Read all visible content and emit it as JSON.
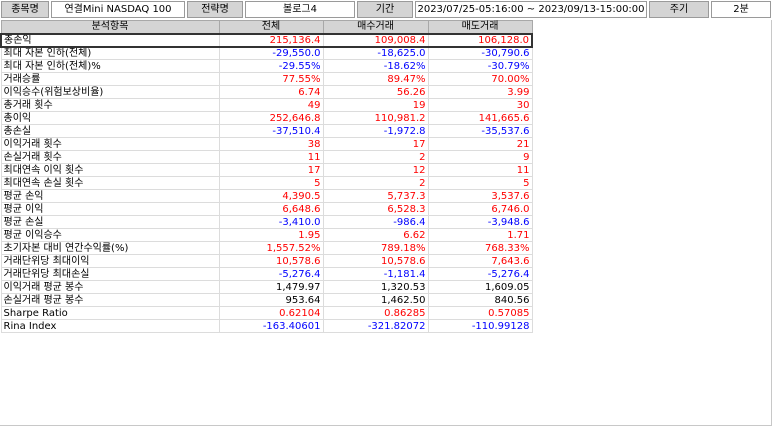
{
  "toolbar": {
    "symbol_label": "종목명",
    "symbol_value": "연결Mini NASDAQ 100",
    "strategy_label": "전략명",
    "strategy_value": "볼로그4",
    "period_label": "기간",
    "period_value": "2023/07/25-05:16:00 ~ 2023/09/13-15:00:00",
    "cycle_label": "주기",
    "cycle_value": "2분"
  },
  "table": {
    "headers": [
      "분석항목",
      "전체",
      "매수거래",
      "매도거래"
    ],
    "rows": [
      {
        "name": "총손익",
        "vals": [
          "215,136.4",
          "109,008.4",
          "106,128.0"
        ],
        "colors": [
          "red",
          "red",
          "red"
        ]
      },
      {
        "name": "최대 자본 인하(전체)",
        "vals": [
          "-29,550.0",
          "-18,625.0",
          "-30,790.6"
        ],
        "colors": [
          "blue",
          "blue",
          "blue"
        ]
      },
      {
        "name": "최대 자본 인하(전체)%",
        "vals": [
          "-29.55%",
          "-18.62%",
          "-30.79%"
        ],
        "colors": [
          "blue",
          "blue",
          "blue"
        ]
      },
      {
        "name": "거래승률",
        "vals": [
          "77.55%",
          "89.47%",
          "70.00%"
        ],
        "colors": [
          "red",
          "red",
          "red"
        ]
      },
      {
        "name": "이익승수(위험보상비율)",
        "vals": [
          "6.74",
          "56.26",
          "3.99"
        ],
        "colors": [
          "red",
          "red",
          "red"
        ]
      },
      {
        "name": "총거래 횟수",
        "vals": [
          "49",
          "19",
          "30"
        ],
        "colors": [
          "red",
          "red",
          "red"
        ]
      },
      {
        "name": "총이익",
        "vals": [
          "252,646.8",
          "110,981.2",
          "141,665.6"
        ],
        "colors": [
          "red",
          "red",
          "red"
        ]
      },
      {
        "name": "총손실",
        "vals": [
          "-37,510.4",
          "-1,972.8",
          "-35,537.6"
        ],
        "colors": [
          "blue",
          "blue",
          "blue"
        ]
      },
      {
        "name": "이익거래 횟수",
        "vals": [
          "38",
          "17",
          "21"
        ],
        "colors": [
          "red",
          "red",
          "red"
        ]
      },
      {
        "name": "손실거래 횟수",
        "vals": [
          "11",
          "2",
          "9"
        ],
        "colors": [
          "red",
          "red",
          "red"
        ]
      },
      {
        "name": "최대연속 이익 횟수",
        "vals": [
          "17",
          "12",
          "11"
        ],
        "colors": [
          "red",
          "red",
          "red"
        ]
      },
      {
        "name": "최대연속 손실 횟수",
        "vals": [
          "5",
          "2",
          "5"
        ],
        "colors": [
          "red",
          "red",
          "red"
        ]
      },
      {
        "name": "평균 손익",
        "vals": [
          "4,390.5",
          "5,737.3",
          "3,537.6"
        ],
        "colors": [
          "red",
          "red",
          "red"
        ]
      },
      {
        "name": "평균 이익",
        "vals": [
          "6,648.6",
          "6,528.3",
          "6,746.0"
        ],
        "colors": [
          "red",
          "red",
          "red"
        ]
      },
      {
        "name": "평균 손실",
        "vals": [
          "-3,410.0",
          "-986.4",
          "-3,948.6"
        ],
        "colors": [
          "blue",
          "blue",
          "blue"
        ]
      },
      {
        "name": "평균 이익승수",
        "vals": [
          "1.95",
          "6.62",
          "1.71"
        ],
        "colors": [
          "red",
          "red",
          "red"
        ]
      },
      {
        "name": "초기자본 대비 연간수익률(%)",
        "vals": [
          "1,557.52%",
          "789.18%",
          "768.33%"
        ],
        "colors": [
          "red",
          "red",
          "red"
        ]
      },
      {
        "name": "거래단위당 최대이익",
        "vals": [
          "10,578.6",
          "10,578.6",
          "7,643.6"
        ],
        "colors": [
          "red",
          "red",
          "red"
        ]
      },
      {
        "name": "거래단위당 최대손실",
        "vals": [
          "-5,276.4",
          "-1,181.4",
          "-5,276.4"
        ],
        "colors": [
          "blue",
          "blue",
          "blue"
        ]
      },
      {
        "name": "이익거래 평균 봉수",
        "vals": [
          "1,479.97",
          "1,320.53",
          "1,609.05"
        ],
        "colors": [
          "black",
          "black",
          "black"
        ]
      },
      {
        "name": "손실거래 평균 봉수",
        "vals": [
          "953.64",
          "1,462.50",
          "840.56"
        ],
        "colors": [
          "black",
          "black",
          "black"
        ]
      },
      {
        "name": "Sharpe Ratio",
        "vals": [
          "0.62104",
          "0.86285",
          "0.57085"
        ],
        "colors": [
          "red",
          "red",
          "red"
        ]
      },
      {
        "name": "Rina Index",
        "vals": [
          "-163.40601",
          "-321.82072",
          "-110.99128"
        ],
        "colors": [
          "blue",
          "blue",
          "blue"
        ]
      }
    ]
  },
  "colors": {
    "red": "#ff0000",
    "blue": "#0000ff",
    "black": "#000000",
    "header_bg": "#d4d4d4"
  }
}
